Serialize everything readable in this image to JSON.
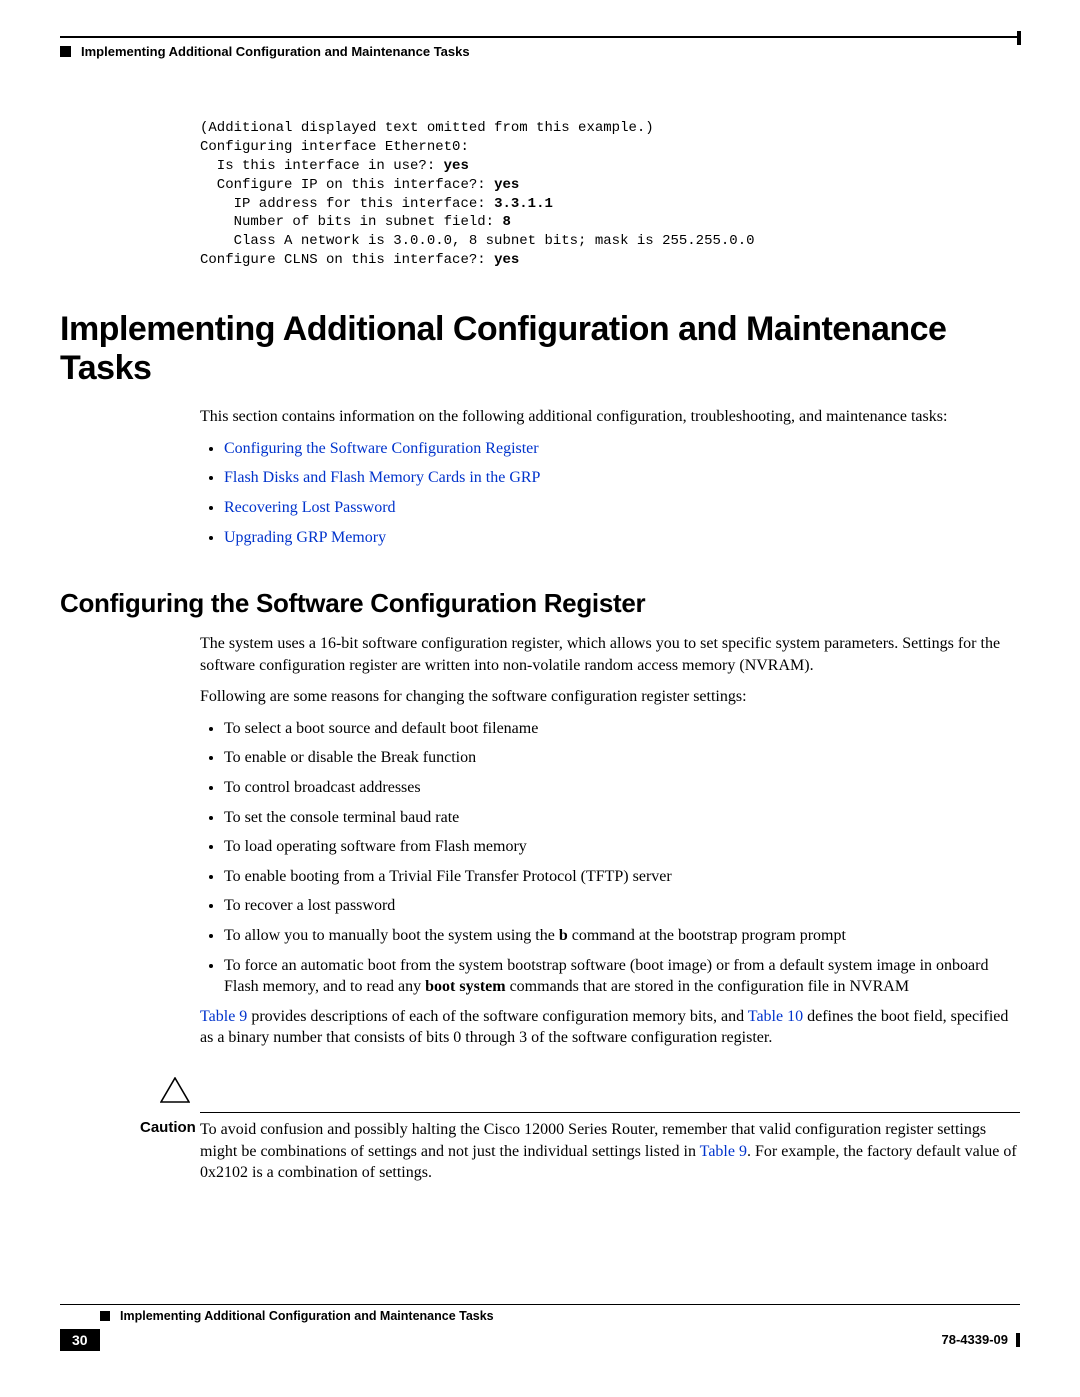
{
  "running_header": "Implementing Additional Configuration and Maintenance Tasks",
  "code": {
    "l1": "(Additional displayed text omitted from this example.)",
    "l2": "Configuring interface Ethernet0:",
    "l3": "  Is this interface in use?: ",
    "l3b": "yes",
    "l4": "  Configure IP on this interface?: ",
    "l4b": "yes",
    "l5": "    IP address for this interface: ",
    "l5b": "3.3.1.1",
    "l6": "    Number of bits in subnet field: ",
    "l6b": "8",
    "l7": "    Class A network is 3.0.0.0, 8 subnet bits; mask is 255.255.0.0",
    "l8": "Configure CLNS on this interface?: ",
    "l8b": "yes"
  },
  "h1": "Implementing Additional Configuration and Maintenance Tasks",
  "intro": "This section contains information on the following additional configuration, troubleshooting, and maintenance tasks:",
  "links": [
    "Configuring the Software Configuration Register",
    "Flash Disks and Flash Memory Cards in the GRP",
    "Recovering Lost Password",
    "Upgrading GRP Memory"
  ],
  "h2": "Configuring the Software Configuration Register",
  "para1": "The system uses a 16-bit software configuration register, which allows you to set specific system parameters. Settings for the software configuration register are written into non-volatile random access memory (NVRAM).",
  "para2": "Following are some reasons for changing the software configuration register settings:",
  "reasons": {
    "r1": "To select a boot source and default boot filename",
    "r2": "To enable or disable the Break function",
    "r3": "To control broadcast addresses",
    "r4": "To set the console terminal baud rate",
    "r5": "To load operating software from Flash memory",
    "r6": "To enable booting from a Trivial File Transfer Protocol (TFTP) server",
    "r7": "To recover a lost password",
    "r8a": "To allow you to manually boot the system using the ",
    "r8b": "b",
    "r8c": " command at the bootstrap program prompt",
    "r9a": "To force an automatic boot from the system bootstrap software (boot image) or from a default system image in onboard Flash memory, and to read any ",
    "r9b": "boot system",
    "r9c": " commands that are stored in the configuration file in NVRAM"
  },
  "para3a": " provides descriptions of each of the software configuration memory bits, and ",
  "para3b": " defines the boot field, specified as a binary number that consists of bits 0 through 3 of the software configuration register.",
  "table9": "Table 9",
  "table10": "Table 10",
  "caution_label": "Caution",
  "caution_a": "To avoid confusion and possibly halting the Cisco 12000 Series Router, remember that valid configuration register settings might be combinations of settings and not just the individual settings listed in ",
  "caution_b": ". For example, the factory default value of 0x2102 is a combination of settings.",
  "footer_running": "Implementing Additional Configuration and Maintenance Tasks",
  "page_number": "30",
  "doc_id": "78-4339-09"
}
